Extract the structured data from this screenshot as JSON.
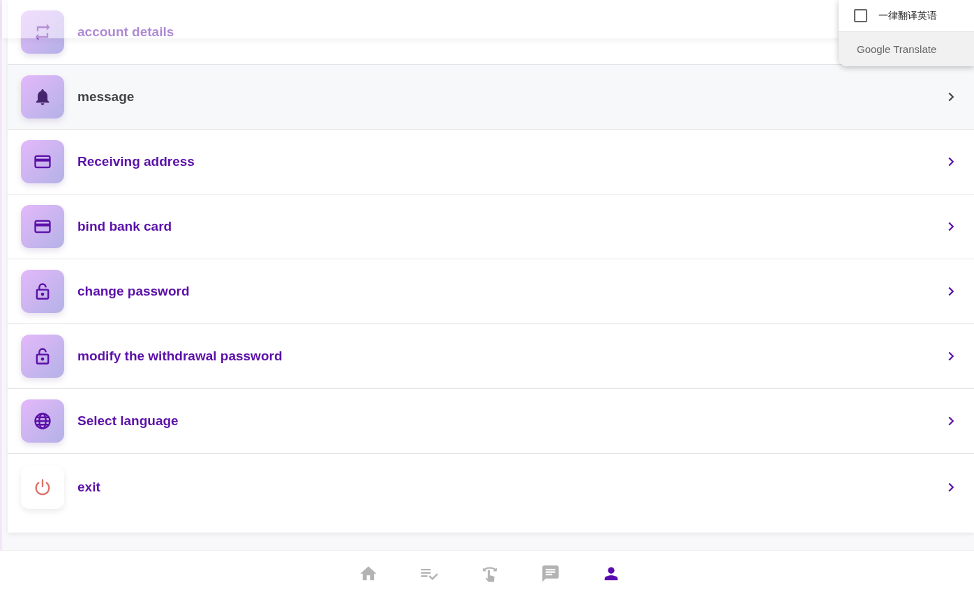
{
  "menu": [
    {
      "kind": "swap",
      "label": "account details",
      "highlighted": false
    },
    {
      "kind": "bell",
      "label": "message",
      "highlighted": true
    },
    {
      "kind": "card",
      "label": "Receiving address",
      "highlighted": false
    },
    {
      "kind": "card",
      "label": "bind bank card",
      "highlighted": false
    },
    {
      "kind": "lock",
      "label": "change password",
      "highlighted": false
    },
    {
      "kind": "lock",
      "label": "modify the withdrawal password",
      "highlighted": false
    },
    {
      "kind": "globe",
      "label": "Select language",
      "highlighted": false
    },
    {
      "kind": "power",
      "label": "exit",
      "highlighted": false
    }
  ],
  "translate_popup": {
    "checkbox": {
      "label": "一律翻译英语",
      "checked": false
    },
    "footer": "Google Translate"
  },
  "bottom_nav": [
    {
      "kind": "home",
      "selected": false
    },
    {
      "kind": "checklist",
      "selected": false
    },
    {
      "kind": "swipe",
      "selected": false
    },
    {
      "kind": "chat",
      "selected": false
    },
    {
      "kind": "person",
      "selected": true
    }
  ]
}
